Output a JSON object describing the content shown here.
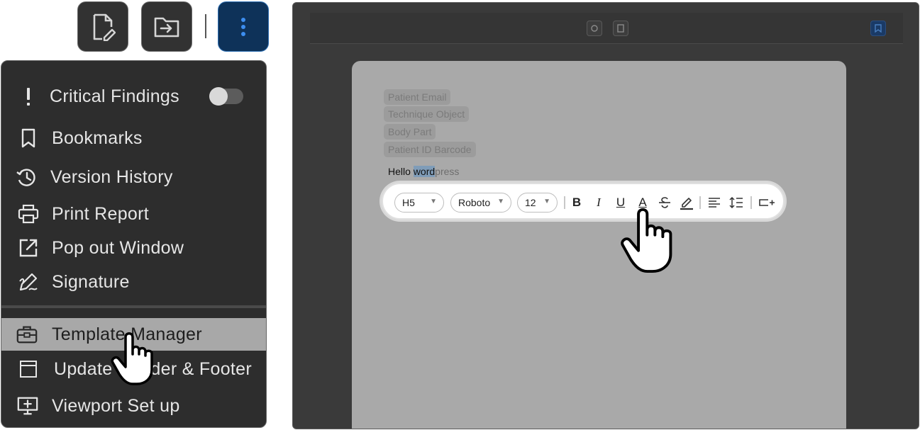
{
  "toolbar": {
    "buttons": [
      {
        "icon": "file-edit-icon"
      },
      {
        "icon": "folder-import-icon"
      },
      {
        "icon": "more-vertical-icon",
        "active": true
      }
    ]
  },
  "menu": {
    "items": [
      {
        "label": "Critical Findings",
        "icon": "exclamation-icon",
        "toggle": false
      },
      {
        "label": "Bookmarks",
        "icon": "bookmark-icon"
      },
      {
        "label": "Version History",
        "icon": "history-icon"
      },
      {
        "label": "Print Report",
        "icon": "printer-icon"
      },
      {
        "label": "Pop out Window",
        "icon": "external-link-icon"
      },
      {
        "label": "Signature",
        "icon": "signature-icon"
      },
      {
        "label": "Template Manager",
        "icon": "briefcase-icon",
        "highlighted": true
      },
      {
        "label": "Update Header & Footer",
        "icon": "layout-icon"
      },
      {
        "label": "Viewport Set up",
        "icon": "monitor-plus-icon"
      }
    ]
  },
  "editor": {
    "chips": [
      "Patient Email",
      "Technique Object",
      "Body Part",
      "Patient ID Barcode"
    ],
    "text": {
      "before": "Hello ",
      "selected": "word",
      "after": "press"
    },
    "format_toolbar": {
      "heading": "H5",
      "font": "Roboto",
      "size": "12",
      "bold": "B",
      "italic": "I",
      "underline": "U",
      "text_color": "A"
    }
  },
  "colors": {
    "menu_bg": "#2d2d2d",
    "highlight": "#a8a8a8",
    "active_button": "#0e3259",
    "accent": "#2f7fe0"
  }
}
